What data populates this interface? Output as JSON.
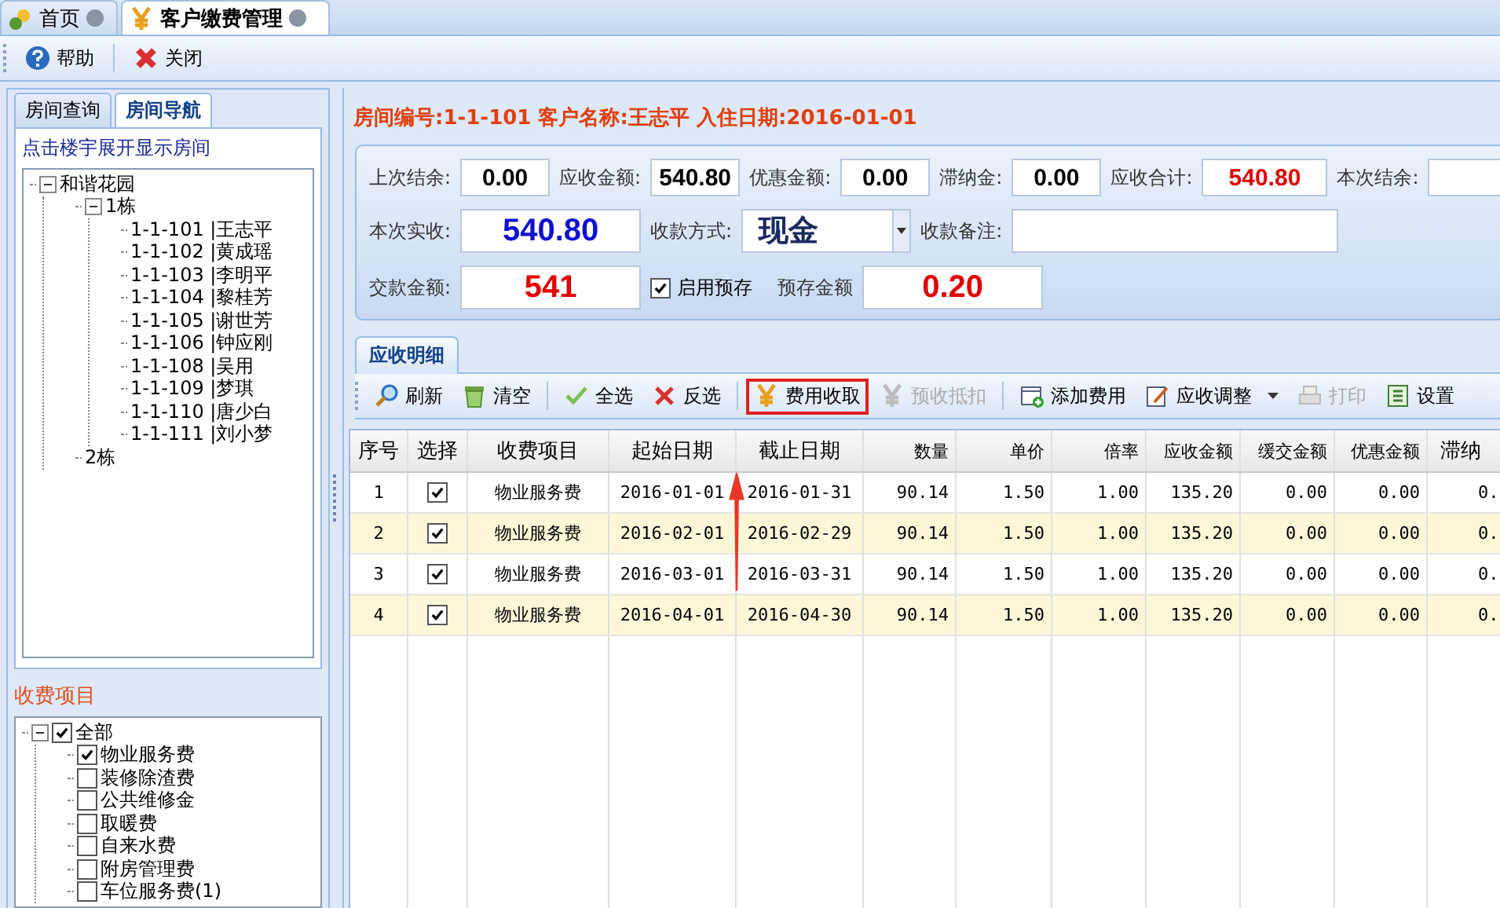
{
  "tabs": [
    {
      "label": "首页",
      "selected": false
    },
    {
      "label": "客户缴费管理",
      "selected": true
    }
  ],
  "toolbar": [
    {
      "label": "帮助"
    },
    {
      "label": "关闭"
    }
  ],
  "left_panel": {
    "tabs": [
      {
        "label": "房间查询",
        "selected": false
      },
      {
        "label": "房间导航",
        "selected": true
      }
    ],
    "hint": "点击楼宇展开显示房间",
    "room_tree": [
      {
        "label": "和谐花园",
        "expanded": true,
        "children": [
          {
            "label": "1栋",
            "expanded": true,
            "children": [
              {
                "label": "1-1-101 |王志平"
              },
              {
                "label": "1-1-102 |黄成瑶"
              },
              {
                "label": "1-1-103 |李明平"
              },
              {
                "label": "1-1-104 |黎桂芳"
              },
              {
                "label": "1-1-105 |谢世芳"
              },
              {
                "label": "1-1-106 |钟应刚"
              },
              {
                "label": "1-1-108 |吴用"
              },
              {
                "label": "1-1-109 |梦琪"
              },
              {
                "label": "1-1-110 |唐少白"
              },
              {
                "label": "1-1-111 |刘小梦"
              }
            ]
          },
          {
            "label": "2栋"
          }
        ]
      }
    ],
    "fee_items_title": "收费项目",
    "fee_tree": [
      {
        "label": "全部",
        "checked": true,
        "expanded": true,
        "children": [
          {
            "label": "物业服务费",
            "checked": true
          },
          {
            "label": "装修除渣费",
            "checked": false
          },
          {
            "label": "公共维修金",
            "checked": false
          },
          {
            "label": "取暖费",
            "checked": false
          },
          {
            "label": "自来水费",
            "checked": false
          },
          {
            "label": "附房管理费",
            "checked": false
          },
          {
            "label": "车位服务费(1)",
            "checked": false
          }
        ]
      }
    ]
  },
  "info_title": "房间编号:1-1-101 客户名称:王志平 入住日期:2016-01-01",
  "form_rows": [
    [
      {
        "kind": "amount",
        "label": "上次结余:",
        "value": "0.00",
        "color": "#000000"
      },
      {
        "kind": "amount",
        "label": "应收金额:",
        "value": "540.80",
        "color": "#000000"
      },
      {
        "kind": "amount",
        "label": "优惠金额:",
        "value": "0.00",
        "color": "#000000"
      },
      {
        "kind": "amount",
        "label": "滞纳金:",
        "value": "0.00",
        "color": "#000000"
      },
      {
        "kind": "total",
        "label": "应收合计:",
        "value": "540.80",
        "color": "#e00000"
      },
      {
        "kind": "amount",
        "label": "本次结余:"
      }
    ],
    [
      {
        "kind": "big",
        "label": "本次实收:",
        "value": "540.80",
        "color": "#1010d0"
      },
      {
        "kind": "select",
        "label": "收款方式:",
        "value": "现金"
      },
      {
        "kind": "text",
        "label": "收款备注:"
      }
    ],
    [
      {
        "kind": "big",
        "label": "交款金额:",
        "value": "541",
        "color": "#e00000"
      },
      {
        "kind": "checkbox",
        "label": "启用预存",
        "checked": true
      },
      {
        "kind": "big",
        "label": "预存金额",
        "value": "0.20",
        "color": "#e00000"
      }
    ]
  ],
  "detail": {
    "tab": "应收明细",
    "toolbar": [
      {
        "label": "刷新",
        "disabled": false,
        "highlighted": false
      },
      {
        "label": "清空",
        "disabled": false,
        "highlighted": false
      },
      {
        "label": "全选",
        "disabled": false,
        "highlighted": false
      },
      {
        "label": "反选",
        "disabled": false,
        "highlighted": false
      },
      {
        "label": "费用收取",
        "disabled": false,
        "highlighted": true
      },
      {
        "label": "预收抵扣",
        "disabled": true,
        "highlighted": false
      },
      {
        "label": "添加费用",
        "disabled": false,
        "highlighted": false
      },
      {
        "label": "应收调整",
        "disabled": false,
        "highlighted": false,
        "has_menu": true
      },
      {
        "label": "打印",
        "disabled": true,
        "highlighted": false
      },
      {
        "label": "设置",
        "disabled": false,
        "highlighted": false
      }
    ],
    "columns": [
      "序号",
      "选择",
      "收费项目",
      "起始日期",
      "截止日期",
      "数量",
      "单价",
      "倍率",
      "应收金额",
      "缓交金额",
      "优惠金额",
      "滞纳"
    ],
    "rows": [
      {
        "cells": [
          "1",
          {
            "checked": true
          },
          "物业服务费",
          "2016-01-01",
          "2016-01-31",
          "90.14",
          "1.50",
          "1.00",
          "135.20",
          "0.00",
          "0.00",
          "0."
        ]
      },
      {
        "cells": [
          "2",
          {
            "checked": true
          },
          "物业服务费",
          "2016-02-01",
          "2016-02-29",
          "90.14",
          "1.50",
          "1.00",
          "135.20",
          "0.00",
          "0.00",
          "0."
        ]
      },
      {
        "cells": [
          "3",
          {
            "checked": true
          },
          "物业服务费",
          "2016-03-01",
          "2016-03-31",
          "90.14",
          "1.50",
          "1.00",
          "135.20",
          "0.00",
          "0.00",
          "0."
        ]
      },
      {
        "cells": [
          "4",
          {
            "checked": true
          },
          "物业服务费",
          "2016-04-01",
          "2016-04-30",
          "90.14",
          "1.50",
          "1.00",
          "135.20",
          "0.00",
          "0.00",
          "0."
        ]
      }
    ],
    "annotation": {
      "kind": "arrow"
    }
  }
}
